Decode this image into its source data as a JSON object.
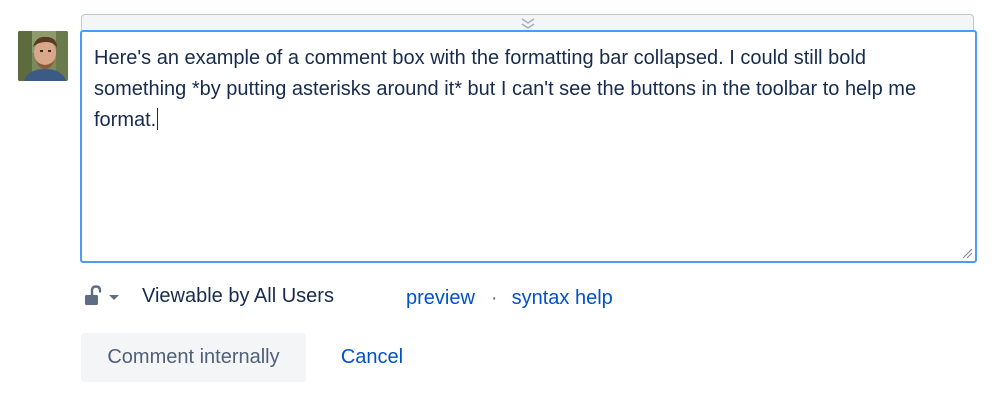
{
  "user": {
    "avatar_icon": "user-photo-avatar"
  },
  "toolbar": {
    "expand_icon": "double-chevron-down-icon",
    "state": "collapsed"
  },
  "comment": {
    "text": "Here's an example of a comment box with the formatting bar collapsed. I could still bold something *by putting asterisks around it* but I can't see the buttons in the toolbar to help me format."
  },
  "visibility": {
    "icon": "unlock-icon",
    "dropdown_icon": "caret-down-icon",
    "label": "Viewable by All Users"
  },
  "links": {
    "preview": "preview",
    "separator": "·",
    "syntax_help": "syntax help"
  },
  "actions": {
    "submit_label": "Comment internally",
    "cancel_label": "Cancel"
  },
  "colors": {
    "focus_border": "#4c9aff",
    "link": "#0052cc",
    "text": "#172b4d",
    "button_bg": "#f4f5f7"
  }
}
